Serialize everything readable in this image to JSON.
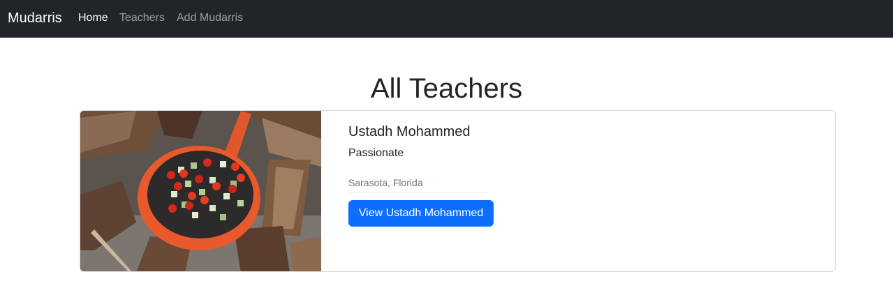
{
  "navbar": {
    "brand": "Mudarris",
    "links": [
      {
        "label": "Home",
        "active": true
      },
      {
        "label": "Teachers",
        "active": false
      },
      {
        "label": "Add Mudarris",
        "active": false
      }
    ]
  },
  "page": {
    "title": "All Teachers"
  },
  "teachers": [
    {
      "name": "Ustadh Mohammed",
      "description": "Passionate",
      "location": "Sarasota, Florida",
      "button_label": "View Ustadh Mohammed",
      "image": "photo-pan-of-vegetables-over-campfire"
    }
  ],
  "colors": {
    "navbar_bg": "#212529",
    "primary_button": "#0d6efd",
    "muted_text": "#6c757d"
  }
}
